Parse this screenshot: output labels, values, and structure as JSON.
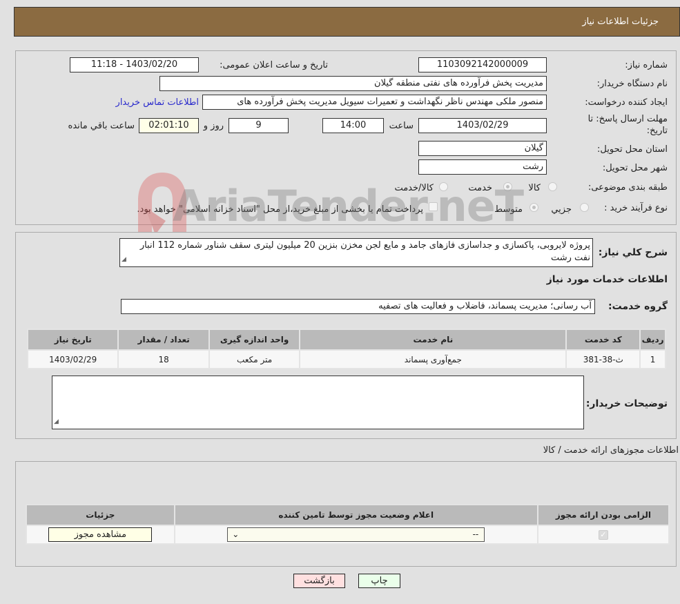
{
  "header": {
    "title": "جزئیات اطلاعات نیاز"
  },
  "form": {
    "need_number_label": "شماره نیاز:",
    "need_number": "1103092142000009",
    "announce_label": "تاریخ و ساعت اعلان عمومی:",
    "announce_value": "1403/02/20 - 11:18",
    "buyer_org_label": "نام دستگاه خریدار:",
    "buyer_org": "مدیریت پخش فرآورده های نفتی منطقه گیلان",
    "requester_label": "ایجاد کننده درخواست:",
    "requester": "منصور ملکی مهندس ناظر نگهداشت و تعمیرات سیویل مدیریت پخش فرآورده های",
    "contact_link": "اطلاعات تماس خریدار",
    "deadline_label_1": "مهلت ارسال پاسخ: تا",
    "deadline_label_2": "تاریخ:",
    "deadline_date": "1403/02/29",
    "time_label": "ساعت",
    "deadline_time": "14:00",
    "days_value": "9",
    "days_label": "روز و",
    "remaining_value": "02:01:10",
    "remaining_label": "ساعت باقي مانده",
    "province_label": "استان محل تحویل:",
    "province": "گیلان",
    "city_label": "شهر محل تحویل:",
    "city": "رشت",
    "category_label": "طبقه بندی موضوعی:",
    "category_options": [
      "کالا",
      "خدمت",
      "کالا/خدمت"
    ],
    "category_selected": "خدمت",
    "process_label": "نوع فرآیند خرید :",
    "process_options": [
      "جزيي",
      "متوسط"
    ],
    "process_selected": "متوسط",
    "payment_note": "پرداخت تمام یا بخشی از مبلغ خرید،از محل \"اسناد خزانه اسلامی\" خواهد بود."
  },
  "details": {
    "description_label": "شرح کلي نياز:",
    "description": "پروژه لایروبی، پاکسازی و جداسازی فازهای جامد و مایع لجن مخزن بنزین 20 میلیون لیتری سقف شناور شماره 112 انبار نفت رشت",
    "services_title": "اطلاعات خدمات مورد نیاز",
    "service_group_label": "گروه خدمت:",
    "service_group": "آب رسانی؛ مدیریت پسماند، فاضلاب و فعالیت های تصفیه",
    "table": {
      "headers": [
        "ردیف",
        "کد خدمت",
        "نام خدمت",
        "واحد اندازه گیری",
        "تعداد / مقدار",
        "تاریخ نیاز"
      ],
      "rows": [
        [
          "1",
          "ث-38-381",
          "جمع‌آوری پسماند",
          "متر مکعب",
          "18",
          "1403/02/29"
        ]
      ]
    },
    "buyer_notes_label": "توضیحات خریدار:",
    "buyer_notes": ""
  },
  "licenses": {
    "title": "اطلاعات مجوزهای ارائه خدمت / کالا",
    "headers": [
      "الزامی بودن ارائه مجوز",
      "اعلام وضعیت مجوز توسط تامین کننده",
      "جزئیات"
    ],
    "row": {
      "required_checked": true,
      "status_value": "--",
      "details_button": "مشاهده مجوز"
    }
  },
  "buttons": {
    "print": "چاپ",
    "back": "بازگشت"
  },
  "watermark": {
    "text": "AriaTender.neT"
  }
}
